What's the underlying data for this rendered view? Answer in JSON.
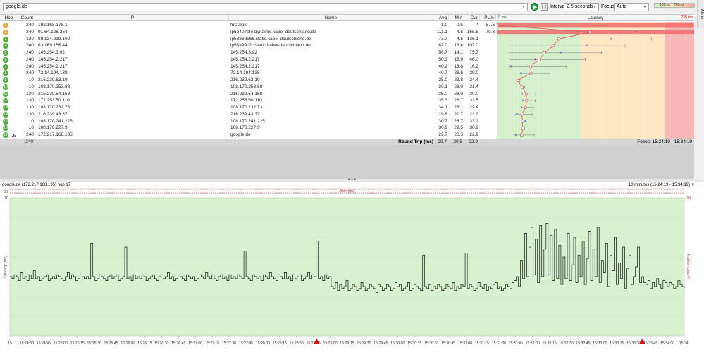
{
  "toolbar": {
    "target": "google.de",
    "interval_label": "Interval",
    "interval_value": "2.5 seconds",
    "focus_label": "Focus",
    "focus_value": "Auto",
    "scale_100": "100ms",
    "scale_200": "200ms",
    "alerts": "Alerts"
  },
  "table": {
    "headers": {
      "hop": "Hop",
      "count": "Count",
      "ip": "IP",
      "name": "Name",
      "avg": "Avg",
      "min": "Min",
      "cur": "Cur",
      "pl": "PL%",
      "latency": "Latency",
      "zero": "0 ms",
      "max": "235 ms"
    },
    "rows": [
      {
        "hop": "1",
        "count": "240",
        "ip": "192.168.178.1",
        "name": "fritz.box",
        "avg": "1.0",
        "min": "0.5",
        "cur": "*",
        "pl": "57.5",
        "status": "warn"
      },
      {
        "hop": "2",
        "count": "240",
        "ip": "91.64.126.254",
        "name": "ip5b407efe.dynamic.kabel-deutschland.de",
        "avg": "111.1",
        "min": "4.5",
        "cur": "165.8",
        "pl": "70.8",
        "status": "warn"
      },
      {
        "hop": "3",
        "count": "120",
        "ip": "88.134.219.102",
        "name": "ip5886db66.static.kabel-deutschland.de",
        "avg": "73.7",
        "min": "4.5",
        "cur": "136.1",
        "pl": "",
        "status": "ok"
      },
      {
        "hop": "4",
        "count": "240",
        "ip": "83.169.156.44",
        "name": "ip53a99c2c.static.kabel-deutschland.de",
        "avg": "67.0",
        "min": "13.4",
        "cur": "107.0",
        "pl": "",
        "status": "ok"
      },
      {
        "hop": "5",
        "count": "240",
        "ip": "145.254.3.92",
        "name": "145.254.3.92",
        "avg": "56.7",
        "min": "14.1",
        "cur": "75.7",
        "pl": "",
        "status": "ok"
      },
      {
        "hop": "6",
        "count": "240",
        "ip": "145.254.2.217",
        "name": "145.254.2.217",
        "avg": "50.3",
        "min": "15.9",
        "cur": "46.0",
        "pl": "",
        "status": "ok"
      },
      {
        "hop": "7",
        "count": "240",
        "ip": "145.254.2.217",
        "name": "145.254.2.217",
        "avg": "40.2",
        "min": "13.8",
        "cur": "16.2",
        "pl": "",
        "status": "ok"
      },
      {
        "hop": "8",
        "count": "240",
        "ip": "72.14.194.138",
        "name": "72.14.194.138",
        "avg": "40.7",
        "min": "26.6",
        "cur": "29.0",
        "pl": "",
        "status": "ok"
      },
      {
        "hop": "9",
        "count": "10",
        "ip": "216.239.63.19",
        "name": "216.239.63.19",
        "avg": "25.0",
        "min": "23.8",
        "cur": "24.4",
        "pl": "",
        "status": "ok"
      },
      {
        "hop": "10",
        "count": "10",
        "ip": "108.170.253.68",
        "name": "108.170.253.68",
        "avg": "30.1",
        "min": "28.0",
        "cur": "31.4",
        "pl": "",
        "status": "ok"
      },
      {
        "hop": "11",
        "count": "130",
        "ip": "216.239.54.168",
        "name": "216.239.54.168",
        "avg": "35.0",
        "min": "28.0",
        "cur": "30.0",
        "pl": "",
        "status": "ok"
      },
      {
        "hop": "12",
        "count": "130",
        "ip": "172.253.50.110",
        "name": "172.253.50.110",
        "avg": "35.3",
        "min": "28.7",
        "cur": "31.5",
        "pl": "",
        "status": "ok"
      },
      {
        "hop": "13",
        "count": "130",
        "ip": "108.170.232.73",
        "name": "108.170.232.73",
        "avg": "34.1",
        "min": "28.1",
        "cur": "29.4",
        "pl": "",
        "status": "ok"
      },
      {
        "hop": "14",
        "count": "130",
        "ip": "216.239.43.37",
        "name": "216.239.43.37",
        "avg": "29.8",
        "min": "21.7",
        "cur": "23.9",
        "pl": "",
        "status": "ok"
      },
      {
        "hop": "15",
        "count": "10",
        "ip": "108.170.241.225",
        "name": "108.170.241.225",
        "avg": "30.7",
        "min": "28.7",
        "cur": "33.2",
        "pl": "",
        "status": "ok"
      },
      {
        "hop": "16",
        "count": "10",
        "ip": "108.170.227.9",
        "name": "108.170.227.9",
        "avg": "30.9",
        "min": "29.5",
        "cur": "30.9",
        "pl": "",
        "status": "ok"
      },
      {
        "hop": "17",
        "count": "240",
        "ip": "172.217.168.195",
        "name": "google.de",
        "avg": "29.7",
        "min": "20.5",
        "cur": "22.9",
        "pl": "",
        "status": "ok"
      }
    ],
    "summary": {
      "count": "240",
      "label": "Round Trip (ms)",
      "avg": "29.7",
      "min": "20.5",
      "cur": "22.9",
      "focus": "Focus: 15:24:19 - 15:34:19"
    }
  },
  "colors": {
    "green": "#d6f0cc",
    "orange": "#fde7c2",
    "red": "#f8b8b8",
    "line": "#d9534f",
    "hop_ok": "#4fa83a",
    "hop_warn": "#e8a33c"
  },
  "chart_data": {
    "type": "line",
    "title": "google.de (172.217.168.195) hop 17",
    "range_label": "10 minutes (15:24:19 - 15:34:19)",
    "close": "✕",
    "jitter_label": "Jitter (ms)",
    "ylabel": "Latency (ms)",
    "y2label": "Packet Loss %",
    "jitter_ticks": [
      "35"
    ],
    "y_ticks": [
      "70"
    ],
    "y2_ticks": [
      "30"
    ],
    "ylim": [
      0,
      70
    ],
    "x_ticks": [
      "15",
      "15:24:30",
      "15:24:45",
      "15:25:00",
      "15:25:15",
      "15:25:30",
      "15:25:45",
      "15:26:00",
      "15:26:15",
      "15:26:30",
      "15:26:45",
      "15:27:00",
      "15:27:15",
      "15:27:30",
      "15:27:45",
      "15:28:00",
      "15:28:15",
      "15:28:30",
      "15:28:45",
      "15:29:00",
      "15:29:15",
      "15:29:30",
      "15:29:45",
      "15:30:00",
      "15:30:15",
      "15:30:30",
      "15:30:45",
      "15:31:00",
      "15:31:15",
      "15:31:30",
      "15:31:45",
      "15:32:00",
      "15:32:15",
      "15:32:30",
      "15:32:45",
      "15:33:00",
      "15:33:15",
      "15:33:30",
      "15:33:45",
      "15:34:00",
      "15:34:"
    ],
    "loss_markers_x_index": [
      18.2,
      37.5
    ],
    "values": [
      30,
      29,
      31,
      30,
      28,
      32,
      29,
      30,
      28,
      31,
      29,
      33,
      29,
      30,
      28,
      29,
      30,
      31,
      28,
      29,
      30,
      29,
      31,
      30,
      29,
      28,
      30,
      32,
      29,
      31,
      30,
      28,
      29,
      31,
      30,
      29,
      30,
      29,
      47,
      30,
      28,
      29,
      31,
      30,
      29,
      28,
      30,
      31,
      29,
      30,
      31,
      28,
      29,
      30,
      45,
      29,
      30,
      28,
      31,
      29,
      30,
      29,
      31,
      30,
      28,
      29,
      30,
      31,
      29,
      28,
      30,
      31,
      29,
      30,
      32,
      29,
      30,
      28,
      29,
      31,
      30,
      29,
      28,
      31,
      30,
      29,
      30,
      28,
      29,
      31,
      30,
      29,
      32,
      30,
      29,
      31,
      29,
      28,
      30,
      31,
      29,
      30,
      28,
      31,
      29,
      30,
      29,
      31,
      30,
      29,
      43,
      30,
      29,
      28,
      31,
      30,
      29,
      30,
      28,
      31,
      30,
      29,
      32,
      30,
      29,
      28,
      31,
      30,
      29,
      32,
      29,
      30,
      28,
      31,
      29,
      30,
      31,
      28,
      29,
      30,
      32,
      29,
      31,
      30,
      48,
      29,
      30,
      28,
      31,
      29,
      30,
      25,
      24,
      27,
      23,
      26,
      24,
      25,
      28,
      23,
      24,
      26,
      25,
      23,
      24,
      27,
      25,
      23,
      24,
      26,
      25,
      24,
      22,
      26,
      25,
      23,
      24,
      26,
      25,
      23,
      24,
      27,
      25,
      26,
      23,
      24,
      25,
      27,
      23,
      24,
      26,
      25,
      24,
      23,
      41,
      25,
      24,
      26,
      23,
      25,
      24,
      26,
      25,
      23,
      24,
      26,
      25,
      24,
      27,
      23,
      25,
      24,
      26,
      25,
      42,
      24,
      26,
      25,
      23,
      24,
      27,
      25,
      24,
      26,
      23,
      25,
      24,
      26,
      27,
      24,
      25,
      23,
      24,
      26,
      25,
      24,
      27,
      28,
      30,
      25,
      38,
      29,
      52,
      30,
      45,
      55,
      31,
      49,
      27,
      56,
      30,
      44,
      57,
      31,
      51,
      28,
      54,
      29,
      46,
      26,
      40,
      29,
      52,
      28,
      36,
      50,
      27,
      41,
      30,
      48,
      26,
      39,
      53,
      28,
      44,
      30,
      55,
      27,
      38,
      32,
      47,
      25,
      41,
      33,
      50,
      26,
      37,
      29,
      45,
      24,
      34,
      41,
      26,
      30,
      35,
      45,
      27,
      30,
      27,
      26,
      28,
      24,
      27,
      25,
      29,
      26,
      24,
      28,
      27,
      25,
      27,
      26,
      24,
      25,
      28,
      26,
      25,
      24
    ]
  }
}
